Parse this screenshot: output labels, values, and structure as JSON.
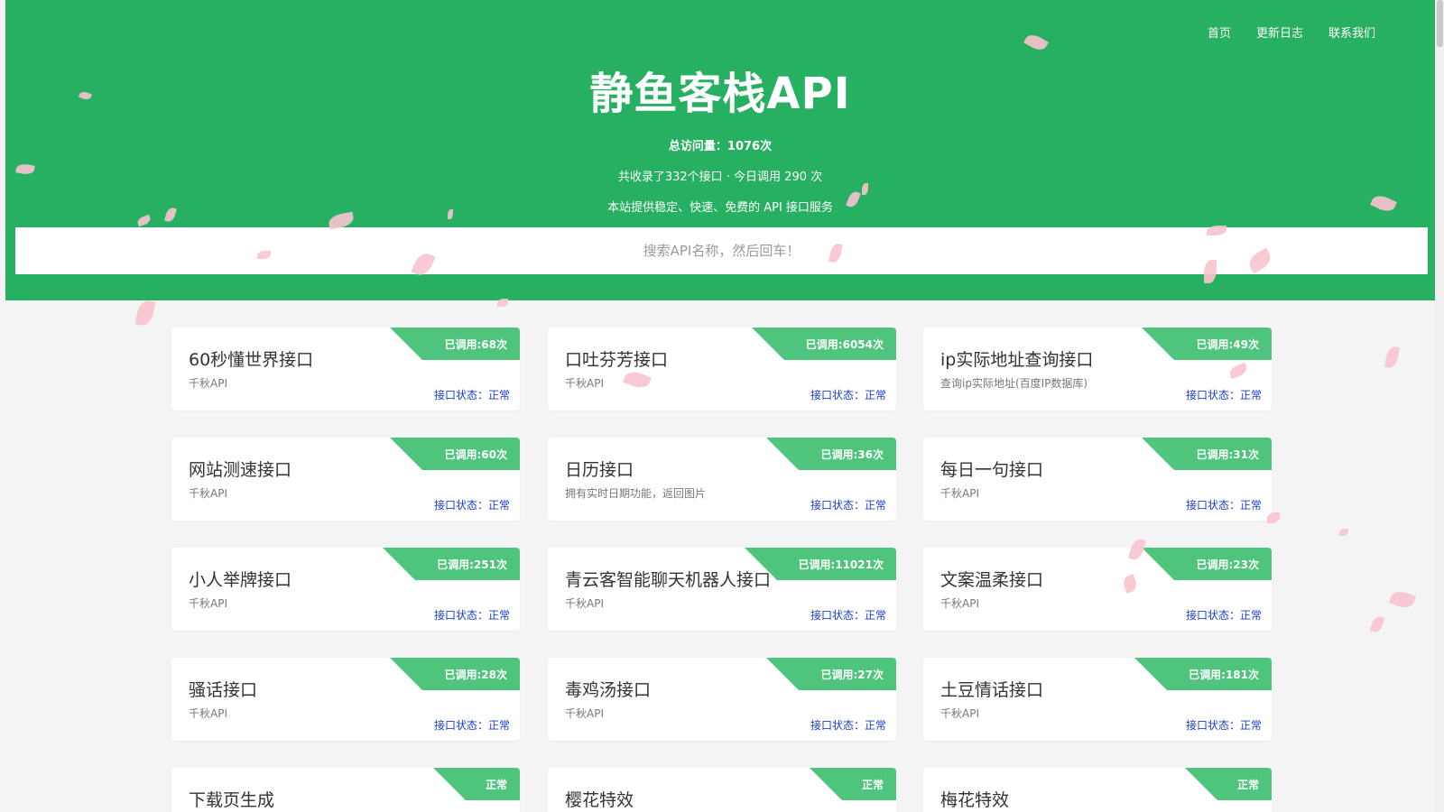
{
  "nav": {
    "items": [
      "首页",
      "更新日志",
      "联系我们"
    ]
  },
  "header": {
    "title": "静鱼客栈API",
    "total_visits": "总访问量：1076次",
    "summary": "共收录了332个接口 · 今日调用 290 次",
    "tagline": "本站提供稳定、快速、免费的 API 接口服务"
  },
  "search": {
    "placeholder": "搜索API名称，然后回车！"
  },
  "cards": [
    {
      "title": "60秒懂世界接口",
      "desc": "千秋API",
      "badge": "已调用:68次",
      "status": "接口状态：正常"
    },
    {
      "title": "口吐芬芳接口",
      "desc": "千秋API",
      "badge": "已调用:6054次",
      "status": "接口状态：正常"
    },
    {
      "title": "ip实际地址查询接口",
      "desc": "查询ip实际地址(百度IP数据库)",
      "badge": "已调用:49次",
      "status": "接口状态：正常"
    },
    {
      "title": "网站测速接口",
      "desc": "千秋API",
      "badge": "已调用:60次",
      "status": "接口状态：正常"
    },
    {
      "title": "日历接口",
      "desc": "拥有实时日期功能，返回图片",
      "badge": "已调用:36次",
      "status": "接口状态：正常"
    },
    {
      "title": "每日一句接口",
      "desc": "千秋API",
      "badge": "已调用:31次",
      "status": "接口状态：正常"
    },
    {
      "title": "小人举牌接口",
      "desc": "千秋API",
      "badge": "已调用:251次",
      "status": "接口状态：正常"
    },
    {
      "title": "青云客智能聊天机器人接口",
      "desc": "千秋API",
      "badge": "已调用:11021次",
      "status": "接口状态：正常"
    },
    {
      "title": "文案温柔接口",
      "desc": "千秋API",
      "badge": "已调用:23次",
      "status": "接口状态：正常"
    },
    {
      "title": "骚话接口",
      "desc": "千秋API",
      "badge": "已调用:28次",
      "status": "接口状态：正常"
    },
    {
      "title": "毒鸡汤接口",
      "desc": "千秋API",
      "badge": "已调用:27次",
      "status": "接口状态：正常"
    },
    {
      "title": "土豆情话接口",
      "desc": "千秋API",
      "badge": "已调用:181次",
      "status": "接口状态：正常"
    },
    {
      "title": "下载页生成",
      "desc": "",
      "badge": "正常",
      "status": ""
    },
    {
      "title": "樱花特效",
      "desc": "",
      "badge": "正常",
      "status": ""
    },
    {
      "title": "梅花特效",
      "desc": "",
      "badge": "正常",
      "status": ""
    }
  ],
  "colors": {
    "header_green": "#28b062",
    "ribbon_green": "#4ec47d",
    "status_blue": "#1a3ecf",
    "petal_pink": "#f8c3cf"
  }
}
